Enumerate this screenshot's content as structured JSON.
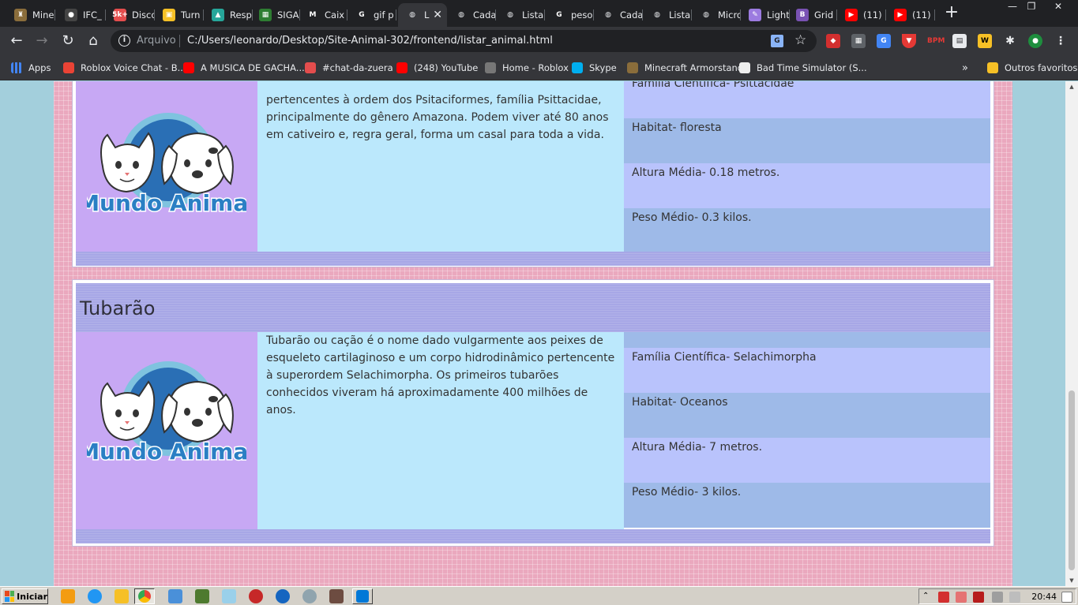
{
  "browser": {
    "tabs": [
      {
        "label": "Mine",
        "color": "#8a6d3b",
        "glyph": "♜"
      },
      {
        "label": "IFC_",
        "color": "#444444",
        "glyph": "●"
      },
      {
        "label": "Disco",
        "color": "#e44d4d",
        "glyph": "5k+"
      },
      {
        "label": "Turn",
        "color": "#f6c026",
        "glyph": "▣"
      },
      {
        "label": "Resp",
        "color": "#26a69a",
        "glyph": "▲"
      },
      {
        "label": "SIGA",
        "color": "#2e7d32",
        "glyph": "▦"
      },
      {
        "label": "Caix",
        "color": "#ffffff",
        "glyph": "M"
      },
      {
        "label": "gif p",
        "color": "#ffffff",
        "glyph": "G"
      },
      {
        "label": "L",
        "color": "#e8eaed",
        "glyph": "◍",
        "active": true
      },
      {
        "label": "Cada",
        "color": "#e8eaed",
        "glyph": "◍"
      },
      {
        "label": "Lista",
        "color": "#e8eaed",
        "glyph": "◍"
      },
      {
        "label": "peso",
        "color": "#ffffff",
        "glyph": "G"
      },
      {
        "label": "Cada",
        "color": "#e8eaed",
        "glyph": "◍"
      },
      {
        "label": "Lista",
        "color": "#e8eaed",
        "glyph": "◍"
      },
      {
        "label": "Micro",
        "color": "#e8eaed",
        "glyph": "◍"
      },
      {
        "label": "Light",
        "color": "#9c7be0",
        "glyph": "✎"
      },
      {
        "label": "Grid",
        "color": "#7952b3",
        "glyph": "B"
      },
      {
        "label": "(11)",
        "color": "#ff0000",
        "glyph": "▶"
      },
      {
        "label": "(11)",
        "color": "#ff0000",
        "glyph": "▶"
      }
    ],
    "new_tab": "+",
    "window_controls": [
      "—",
      "❐",
      "✕"
    ],
    "nav": {
      "back": "←",
      "forward": "→",
      "reload": "↻",
      "home": "⌂"
    },
    "address": {
      "protocol": "Arquivo",
      "url": "C:/Users/leonardo/Desktop/Site-Animal-302/frontend/listar_animal.html"
    },
    "bookmarks": [
      {
        "label": "Apps",
        "color": "#4285f4"
      },
      {
        "label": "Roblox Voice Chat - B...",
        "color": "#ea4335"
      },
      {
        "label": "A MUSICA DE GACHA...",
        "color": "#ff0000"
      },
      {
        "label": "#chat-da-zuera",
        "color": "#e44d4d"
      },
      {
        "label": "(248) YouTube",
        "color": "#ff0000"
      },
      {
        "label": "Home - Roblox",
        "color": "#777777"
      },
      {
        "label": "Skype",
        "color": "#00aff0"
      },
      {
        "label": "Minecraft Armorstand",
        "color": "#8a6d3b"
      },
      {
        "label": "Bad Time Simulator (S...",
        "color": "#eeeeee"
      }
    ],
    "bookmarks_more": "»",
    "other_bookmarks": "Outros favoritos"
  },
  "animals": [
    {
      "name": "",
      "description": "pertencentes à ordem dos Psitaciformes, família Psittacidae, principalmente do gênero Amazona. Podem viver até 80 anos em cativeiro e, regra geral, forma um casal para toda a vida.",
      "family": "Família Científica- Psittacidae",
      "habitat": "Habitat- floresta",
      "height": "Altura Média- 0.18 metros.",
      "weight": "Peso Médio- 0.3 kilos."
    },
    {
      "name": "Tubarão",
      "description": "Tubarão ou cação é o nome dado vulgarmente aos peixes de esqueleto cartilaginoso e um corpo hidrodinâmico pertencente à superordem Selachimorpha. Os primeiros tubarões conhecidos viveram há aproximadamente 400 milhões de anos.",
      "family": "Família Científica- Selachimorpha",
      "habitat": "Habitat- Oceanos",
      "height": "Altura Média- 7 metros.",
      "weight": "Peso Médio- 3 kilos."
    }
  ],
  "logo_text": "Mundo Animal",
  "taskbar": {
    "start_label": "Iniciar",
    "time": "20:44"
  }
}
